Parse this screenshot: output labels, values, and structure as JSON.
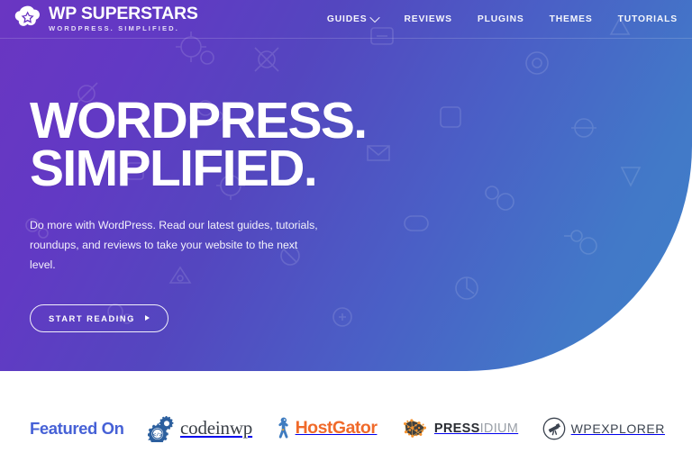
{
  "brand": {
    "name": "WP SUPERSTARS",
    "tagline": "WORDPRESS. SIMPLIFIED.",
    "mark_icon": "star-burst-icon"
  },
  "nav": {
    "items": [
      {
        "label": "GUIDES",
        "has_dropdown": true,
        "icon": "chevron-down-icon"
      },
      {
        "label": "REVIEWS",
        "has_dropdown": false
      },
      {
        "label": "PLUGINS",
        "has_dropdown": false
      },
      {
        "label": "THEMES",
        "has_dropdown": false
      },
      {
        "label": "TUTORIALS",
        "has_dropdown": false
      }
    ]
  },
  "hero": {
    "headline_line1": "WORDPRESS.",
    "headline_line2": "SIMPLIFIED.",
    "subhead_line1": "Do more with WordPress. Read our latest guides, tutorials,",
    "subhead_line2": "roundups, and reviews to take your website to the next level.",
    "cta_label": "START READING",
    "cta_icon": "play-arrow-icon",
    "gradient_from": "#6A36C2",
    "gradient_to": "#3F80C9"
  },
  "featured": {
    "label": "Featured On",
    "label_color": "#4661D6",
    "logos": [
      {
        "name": "codeinwp",
        "text": "codeinwp",
        "icon": "gears-code-icon",
        "color": "#3A3F47"
      },
      {
        "name": "hostgator",
        "text_part1": "Host",
        "text_part2": "Gator",
        "icon": "gator-mascot-icon",
        "color": "#F06A2A"
      },
      {
        "name": "pressidium",
        "text_part1": "PRESS",
        "text_part2": "IDIUM",
        "icon": "dot-mesh-icon",
        "color": "#2A2D33"
      },
      {
        "name": "wpexplorer",
        "text": "WPEXPLORER",
        "icon": "telescope-circle-icon",
        "color": "#3C4450"
      }
    ]
  }
}
